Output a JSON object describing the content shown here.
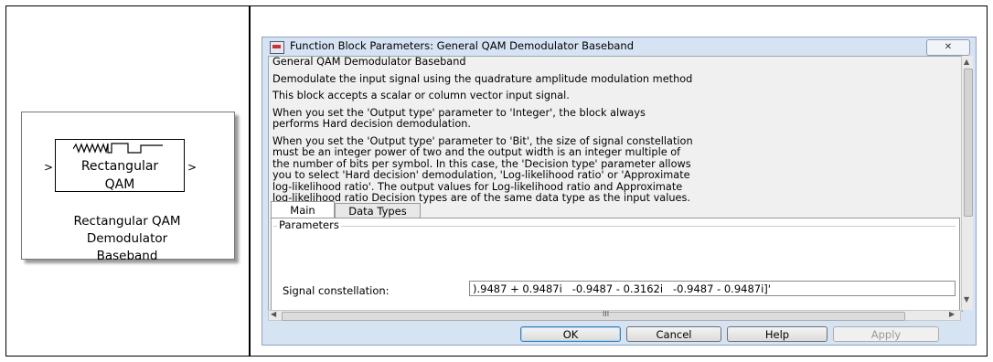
{
  "block": {
    "title_line1": "Rectangular",
    "title_line2": "QAM",
    "port_in": ">",
    "port_out": ">",
    "caption_line1": "Rectangular QAM",
    "caption_line2": "Demodulator",
    "caption_line3": "Baseband"
  },
  "dialog": {
    "title": "Function Block Parameters: General QAM Demodulator Baseband",
    "close_label": "✕",
    "description": {
      "heading": "General QAM Demodulator Baseband",
      "para1": "Demodulate the input signal using the quadrature amplitude modulation method",
      "para2": "This block accepts a scalar or column vector input signal.",
      "para3_line1": "When you set the 'Output type' parameter to 'Integer', the block always",
      "para3_line2": "performs Hard decision demodulation.",
      "para4_line1": "When you set the 'Output type' parameter to 'Bit', the size of signal constellation",
      "para4_line2": "must be an integer power of two and the output width is an integer multiple of",
      "para4_line3": "the number of bits per symbol. In this case, the 'Decision type' parameter allows",
      "para4_line4": "you to select 'Hard decision' demodulation, 'Log-likelihood ratio' or 'Approximate",
      "para4_line5": "log-likelihood ratio'. The output values for Log-likelihood ratio and Approximate",
      "para4_line6": "log-likelihood ratio Decision types are of the same data type as the input values."
    },
    "tabs": [
      {
        "label": "Main"
      },
      {
        "label": "Data Types"
      }
    ],
    "parameters_label": "Parameters",
    "signal_constellation_label": "Signal constellation:",
    "signal_constellation_value": ").9487 + 0.9487i   -0.9487 - 0.3162i   -0.9487 - 0.9487i]'",
    "hscroll_grip": "III",
    "buttons": {
      "ok": "OK",
      "cancel": "Cancel",
      "help": "Help",
      "apply": "Apply"
    }
  }
}
